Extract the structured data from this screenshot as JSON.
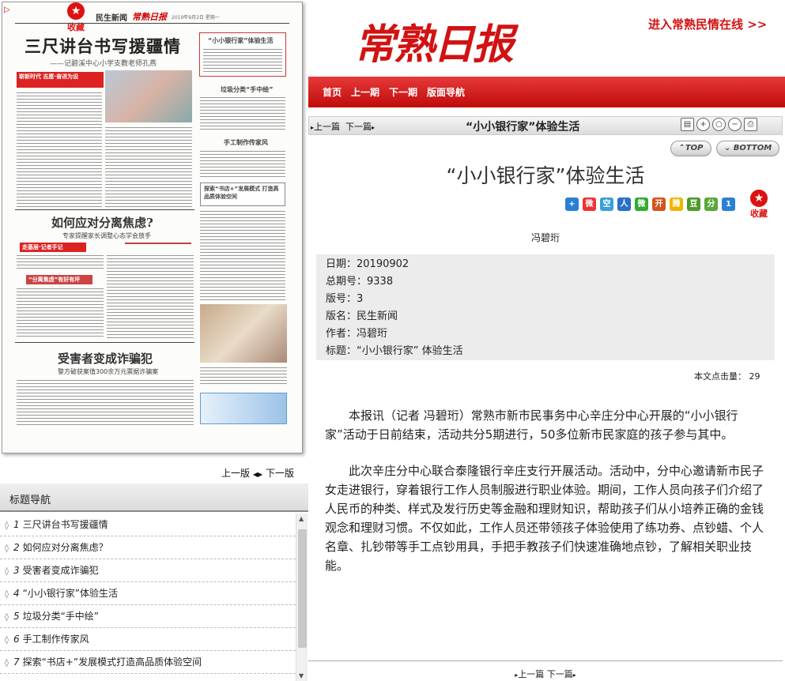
{
  "newspaper": {
    "favorite_label": "收藏",
    "favorite_icon": "star-icon",
    "section_name": "民生新闻",
    "brand_small": "常熟日报",
    "date_line": "2019年9月2日 星期一",
    "headline": "三尺讲台书写援疆情",
    "headline_sub": "——记碧溪中心小学支教老师孔燕",
    "box1_title": "“小小银行家”体验生活",
    "box2_title": "垃圾分类“手中绘”",
    "box3_title": "手工制作传家风",
    "box4_title": "探索“书店+”发展模式 打造高品质体验空间",
    "h2a": "如何应对分离焦虑?",
    "h2a_sub": "专家提醒家长调整心态学会放手",
    "strip_a": "走基层·记者手记",
    "strip_b": "“分离焦虑”有好有坏",
    "h2b": "受害者变成诈骗犯",
    "h2b_sub": "警方破获案值300余万元票据诈骗案",
    "banner_small": "崭新时代 志愿·奋进为设"
  },
  "pager": {
    "prev": "上一版",
    "next": "下一版"
  },
  "title_nav": {
    "header": "标题导航",
    "items": [
      {
        "num": "1",
        "label": "三尺讲台书写援疆情"
      },
      {
        "num": "2",
        "label": "如何应对分离焦虑？"
      },
      {
        "num": "3",
        "label": "受害者变成诈骗犯"
      },
      {
        "num": "4",
        "label": "“小小银行家”体验生活"
      },
      {
        "num": "5",
        "label": "垃圾分类“手中绘”"
      },
      {
        "num": "6",
        "label": "手工制作传家风"
      },
      {
        "num": "7",
        "label": "探索“书店+”发展模式打造高品质体验空间"
      }
    ]
  },
  "header": {
    "logo": "常熟日报",
    "link": "进入常熟民情在线 >>",
    "nav": [
      "首页",
      "上一期",
      "下一期",
      "版面导航"
    ]
  },
  "toolbar": {
    "prev": "上一篇",
    "next": "下一篇",
    "title": "“小小银行家”体验生活"
  },
  "top_button": "TOP",
  "bottom_button": "BOTTOM",
  "article": {
    "title": "“小小银行家”体验生活",
    "author": "冯碧珩",
    "favorite_label": "收藏",
    "meta": [
      {
        "k": "日期：",
        "v": "20190902"
      },
      {
        "k": "总期号：",
        "v": "9338"
      },
      {
        "k": "版号：",
        "v": "3"
      },
      {
        "k": "版名：",
        "v": "民生新闻"
      },
      {
        "k": "作者：",
        "v": "冯碧珩"
      },
      {
        "k": "标题：",
        "v": "“小小银行家” 体验生活"
      }
    ],
    "hits": "本文点击量： 29",
    "paragraphs": [
      "本报讯（记者 冯碧珩）常熟市新市民事务中心辛庄分中心开展的“小小银行家”活动于日前结束，活动共分5期进行，50多位新市民家庭的孩子参与其中。",
      "此次辛庄分中心联合泰隆银行辛庄支行开展活动。活动中，分中心邀请新市民子女走进银行，穿着银行工作人员制服进行职业体验。期间，工作人员向孩子们介绍了人民币的种类、样式及发行历史等金融和理财知识，帮助孩子们从小培养正确的金钱观念和理财习惯。不仅如此，工作人员还带领孩子体验使用了练功券、点钞蜡、个人名章、扎钞带等手工点钞用具，手把手教孩子们快速准确地点钞，了解相关职业技能。"
    ]
  },
  "footer": {
    "prev": "上一篇",
    "next": "下一篇"
  }
}
